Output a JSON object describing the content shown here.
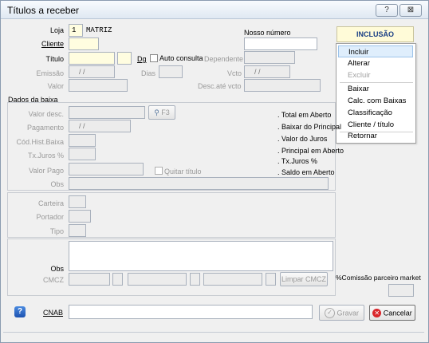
{
  "window": {
    "title": "Títulos a receber",
    "help_btn": "?",
    "close_btn": "⊠"
  },
  "header": {
    "loja_label": "Loja",
    "loja_code": "1",
    "loja_name": "MATRIZ",
    "cliente_label": "Cliente",
    "titulo_label": "Título",
    "dg_label": "Dg",
    "auto_consulta_label": "Auto consulta",
    "dependente_label": "Dependente",
    "emissao_label": "Emissão",
    "emissao_value": "/  /",
    "dias_label": "Dias",
    "vcto_label": "Vcto",
    "vcto_value": "/  /",
    "valor_label": "Valor",
    "desc_vcto_label": "Desc.até vcto",
    "nosso_numero_label": "Nosso número",
    "mode_label": "INCLUSÃO"
  },
  "menu": {
    "items": [
      "Incluir",
      "Alterar",
      "Excluir",
      "Baixar",
      "Calc. com Baixas",
      "Classificação",
      "Cliente / título",
      "Retornar"
    ]
  },
  "baixa": {
    "section_label": "Dados da baixa",
    "valor_desc_label": "Valor desc.",
    "f3_label": "F3",
    "pagamento_label": "Pagamento",
    "pagamento_value": "/  /",
    "cod_hist_label": "Cód.Hist.Baixa",
    "tx_juros_label": "Tx.Juros %",
    "valor_pago_label": "Valor Pago",
    "quitar_label": "Quitar título",
    "obs_label": "Obs",
    "totals": [
      ". Total em Aberto",
      ". Baixar do Principal",
      ". Valor do Juros",
      ". Principal em Aberto",
      ". Tx.Juros %",
      ". Saldo em Aberto"
    ]
  },
  "cart": {
    "carteira_label": "Carteira",
    "portador_label": "Portador",
    "tipo_label": "Tipo"
  },
  "bottom": {
    "obs_label": "Obs",
    "cmcz_label": "CMCZ",
    "limpar_label": "Limpar CMCZ",
    "comissao_label": "%Comissão parceiro market",
    "cnab_label": "CNAB",
    "gravar_label": "Gravar",
    "cancelar_label": "Cancelar"
  },
  "colors": {
    "accent": "#1a66c2",
    "input_yellow": "#fffde0",
    "mode_bg": "#fffbd8"
  }
}
